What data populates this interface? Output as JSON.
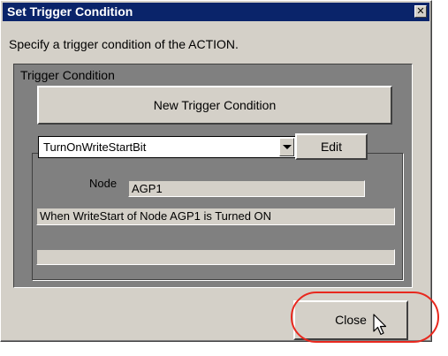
{
  "window": {
    "title": "Set Trigger Condition",
    "close_glyph": "✕"
  },
  "instruction": "Specify a trigger condition of the ACTION.",
  "trigger_panel": {
    "label": "Trigger Condition",
    "new_button": "New Trigger Condition",
    "selected_condition": "TurnOnWriteStartBit",
    "edit_button": "Edit",
    "node_label": "Node",
    "node_value": "AGP1",
    "description": "When WriteStart of Node AGP1 is Turned ON",
    "extra_text": ""
  },
  "close_button": "Close",
  "annotation": {
    "highlight_color": "#e8281e"
  },
  "icons": {
    "dropdown": "chevron-down-icon",
    "cursor": "mouse-pointer-icon"
  }
}
